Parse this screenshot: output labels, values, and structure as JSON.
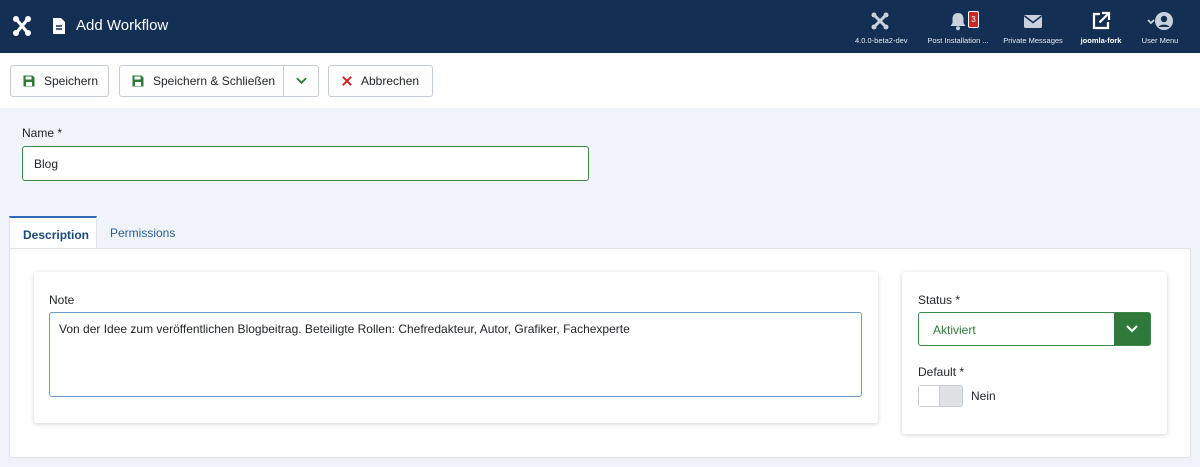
{
  "header": {
    "title": "Add Workflow",
    "logo_icon": "joomla-logo-icon",
    "items": [
      {
        "label": "4.0.0-beta2-dev",
        "icon": "joomla-icon"
      },
      {
        "label": "Post Installation ...",
        "icon": "bell-icon",
        "badge": "3"
      },
      {
        "label": "Private Messages",
        "icon": "envelope-icon"
      },
      {
        "label": "joomla-fork",
        "icon": "external-link-icon"
      },
      {
        "label": "User Menu",
        "icon": "user-icon"
      }
    ]
  },
  "toolbar": {
    "save_label": "Speichern",
    "save_close_label": "Speichern & Schließen",
    "cancel_label": "Abbrechen"
  },
  "form": {
    "name_label": "Name *",
    "name_value": "Blog"
  },
  "tabs": [
    {
      "label": "Description",
      "active": true
    },
    {
      "label": "Permissions",
      "active": false
    }
  ],
  "description": {
    "note_label": "Note",
    "note_value": "Von der Idee zum veröffentlichen Blogbeitrag. Beteiligte Rollen: Chefredakteur, Autor, Grafiker, Fachexperte"
  },
  "sidebar": {
    "status_label": "Status *",
    "status_value": "Aktiviert",
    "default_label": "Default *",
    "default_value": "Nein"
  },
  "colors": {
    "header_bg": "#132f53",
    "success": "#2f7a3a",
    "danger": "#c52827",
    "link": "#2a5e93"
  }
}
